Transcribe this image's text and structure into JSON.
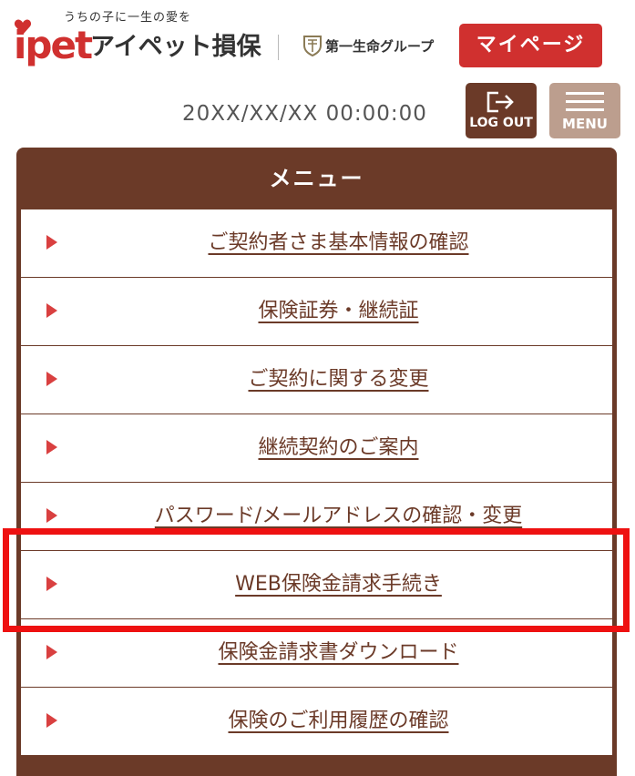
{
  "header": {
    "tagline": "うちの子に一生の愛を",
    "logo_brand": "ipet",
    "logo_name": "アイペット損保",
    "group_name": "第一生命グループ",
    "mypage_label": "マイページ",
    "datetime": "20XX/XX/XX 00:00:00",
    "logout_label": "LOG OUT",
    "menu_label": "MENU"
  },
  "menu": {
    "title": "メニュー",
    "items": [
      {
        "label": "ご契約者さま基本情報の確認"
      },
      {
        "label": "保険証券・継続証"
      },
      {
        "label": "ご契約に関する変更"
      },
      {
        "label": "継続契約のご案内"
      },
      {
        "label": "パスワード/メールアドレスの確認・変更"
      },
      {
        "label": "WEB保険金請求手続き"
      },
      {
        "label": "保険金請求書ダウンロード"
      },
      {
        "label": "保険のご利用履歴の確認"
      }
    ]
  },
  "colors": {
    "brand_red": "#d0302f",
    "menu_brown": "#6b3a28",
    "menu_button": "#bc9e8e",
    "highlight": "#ee1111"
  }
}
